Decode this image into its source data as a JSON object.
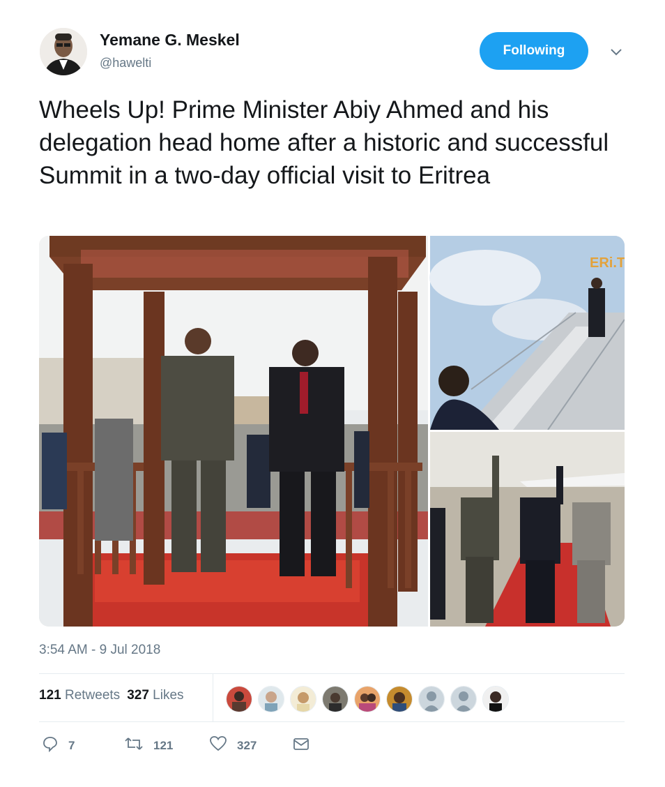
{
  "user": {
    "display_name": "Yemane G. Meskel",
    "handle": "@hawelti",
    "avatar_icon": "profile-photo"
  },
  "follow_button": {
    "label": "Following",
    "color": "#1da1f2"
  },
  "menu_icon": "chevron-down-icon",
  "tweet": {
    "text": "Wheels Up! Prime Minister Abiy Ahmed and his delegation head home after a historic and successful Summit in a two-day official visit to Eritrea",
    "timestamp": "3:54 AM - 9 Jul 2018"
  },
  "media": {
    "photos": [
      {
        "id": "photo-1",
        "description_icon": "ceremony-photo"
      },
      {
        "id": "photo-2",
        "description_icon": "airplane-stairs-photo",
        "overlay_logo": "ERi.TV"
      },
      {
        "id": "photo-3",
        "description_icon": "waving-tarmac-photo"
      }
    ]
  },
  "engagement": {
    "retweets_count": "121",
    "retweets_label": "Retweets",
    "likes_count": "327",
    "likes_label": "Likes",
    "liker_faces": 9
  },
  "actions": {
    "reply_count": "7",
    "retweet_count": "121",
    "like_count": "327"
  },
  "colors": {
    "text_primary": "#14171a",
    "text_secondary": "#657786",
    "divider": "#e6ecf0",
    "accent": "#1da1f2"
  }
}
